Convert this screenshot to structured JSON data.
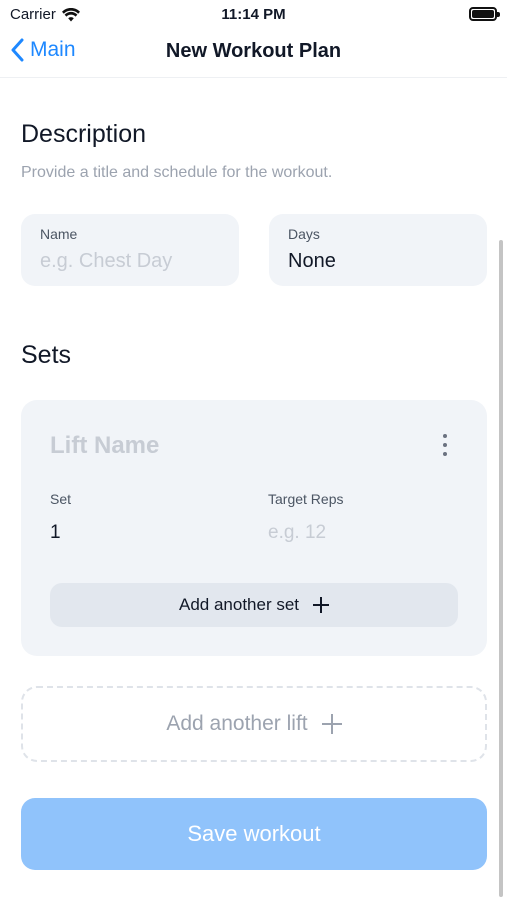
{
  "status_bar": {
    "carrier": "Carrier",
    "time": "11:14 PM"
  },
  "nav": {
    "back_label": "Main",
    "title": "New Workout Plan"
  },
  "description": {
    "title": "Description",
    "subtitle": "Provide a title and schedule for the workout.",
    "name_field": {
      "label": "Name",
      "placeholder": "e.g. Chest Day"
    },
    "days_field": {
      "label": "Days",
      "value": "None"
    }
  },
  "sets": {
    "title": "Sets",
    "lift": {
      "name_placeholder": "Lift Name",
      "set_label": "Set",
      "set_value": "1",
      "reps_label": "Target Reps",
      "reps_placeholder": "e.g. 12",
      "add_set_label": "Add another set"
    },
    "add_lift_label": "Add another lift"
  },
  "save_label": "Save workout",
  "colors": {
    "accent": "#1e88ff",
    "save_disabled": "#90c3fb",
    "field_bg": "#f1f4f8"
  }
}
